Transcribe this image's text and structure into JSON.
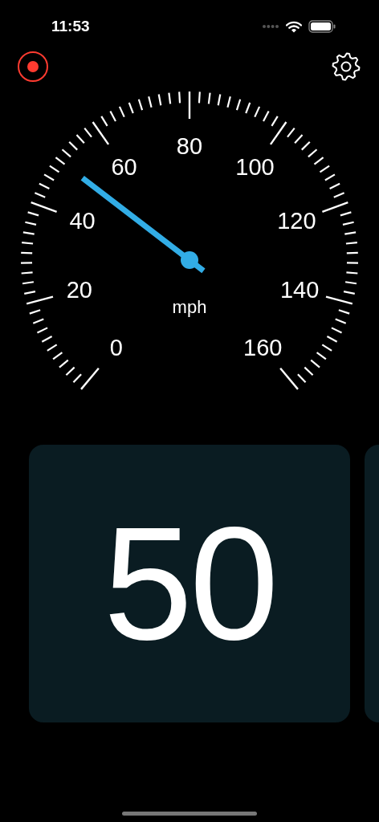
{
  "status_bar": {
    "time": "11:53"
  },
  "gauge": {
    "labels": [
      "0",
      "20",
      "40",
      "60",
      "80",
      "100",
      "120",
      "140",
      "160"
    ],
    "unit": "mph",
    "level": 0.3125
  },
  "speed_card": {
    "value": "50"
  }
}
